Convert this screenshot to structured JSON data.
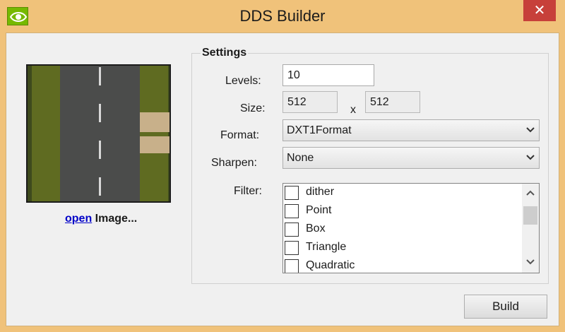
{
  "window": {
    "title": "DDS Builder",
    "close_glyph": "✕",
    "icon": "nvidia-eye-icon"
  },
  "preview": {
    "open_link": "open",
    "open_suffix": " Image..."
  },
  "settings": {
    "title": "Settings",
    "levels": {
      "label": "Levels:",
      "value": "10"
    },
    "size": {
      "label": "Size:",
      "width": "512",
      "separator": "x",
      "height": "512"
    },
    "format": {
      "label": "Format:",
      "value": "DXT1Format"
    },
    "sharpen": {
      "label": "Sharpen:",
      "value": "None"
    },
    "filter": {
      "label": "Filter:",
      "items": [
        {
          "label": "dither",
          "checked": false
        },
        {
          "label": "Point",
          "checked": false
        },
        {
          "label": "Box",
          "checked": false
        },
        {
          "label": "Triangle",
          "checked": false
        },
        {
          "label": "Quadratic",
          "checked": false
        }
      ]
    }
  },
  "actions": {
    "build_label": "Build"
  },
  "colors": {
    "titlebar": "#f0c27a",
    "close": "#c7403a",
    "link": "#0000c8",
    "nvidia_green": "#76b900"
  }
}
